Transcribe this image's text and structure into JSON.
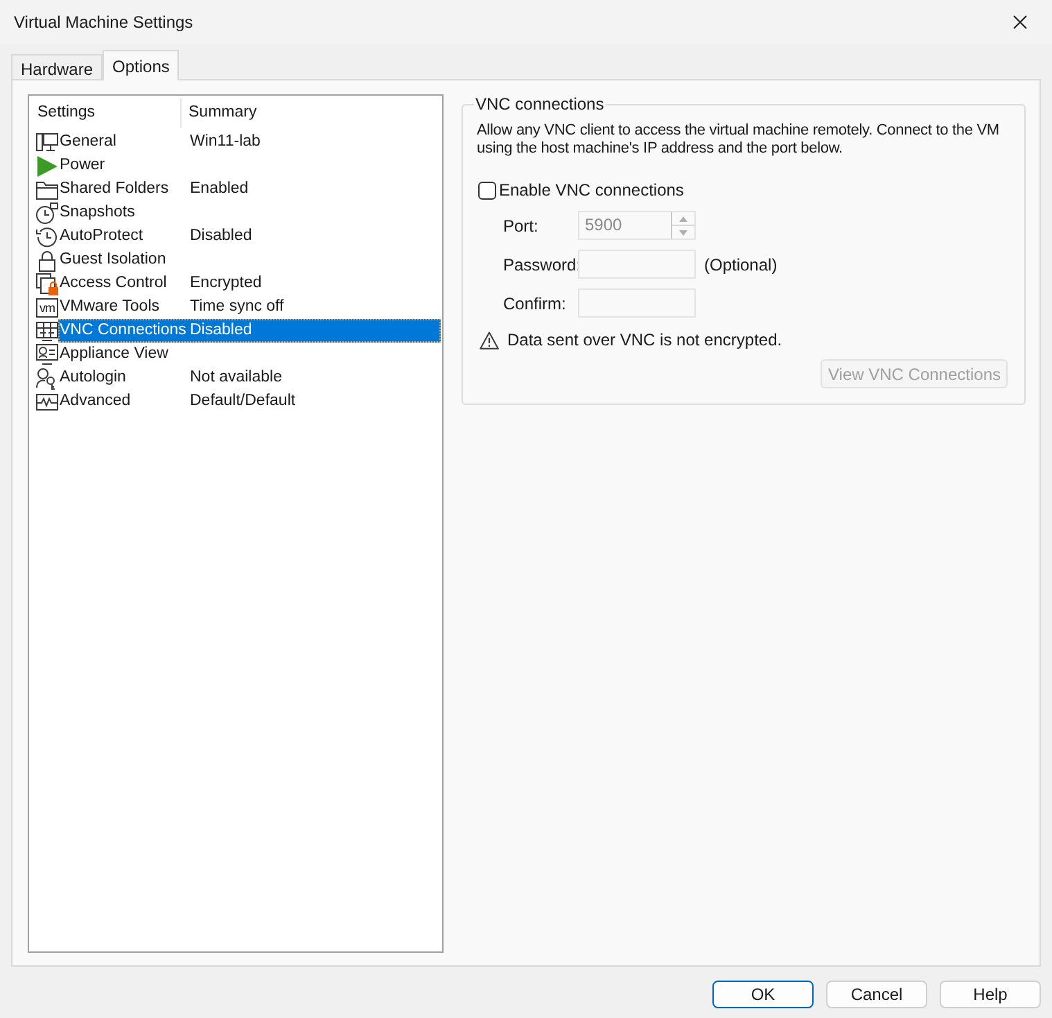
{
  "window": {
    "title": "Virtual Machine Settings"
  },
  "tabs": [
    {
      "label": "Hardware",
      "selected": false
    },
    {
      "label": "Options",
      "selected": true
    }
  ],
  "settings": {
    "columns": [
      "Settings",
      "Summary"
    ],
    "rows": [
      {
        "name": "General",
        "summary": "Win11-lab",
        "selected": false
      },
      {
        "name": "Power",
        "selected": false
      },
      {
        "name": "Shared Folders",
        "summary": "Enabled",
        "selected": false
      },
      {
        "name": "Snapshots",
        "selected": false
      },
      {
        "name": "AutoProtect",
        "summary": "Disabled",
        "selected": false
      },
      {
        "name": "Guest Isolation",
        "selected": false
      },
      {
        "name": "Access Control",
        "summary": "Encrypted",
        "selected": false
      },
      {
        "name": "VMware Tools",
        "summary": "Time sync off",
        "logo": "vm",
        "selected": false
      },
      {
        "name": "VNC Connections",
        "summary": "Disabled",
        "selected": true
      },
      {
        "name": "Appliance View",
        "selected": false
      },
      {
        "name": "Autologin",
        "summary": "Not available",
        "selected": false
      },
      {
        "name": "Advanced",
        "summary": "Default/Default",
        "selected": false
      }
    ]
  },
  "vnc": {
    "legend": "VNC connections",
    "description": "Allow any VNC client to access the virtual machine remotely. Connect to the VM using the host machine's IP address and the port below.",
    "enable": {
      "label": "Enable VNC connections",
      "checked": false
    },
    "fields": [
      {
        "kind": "spinner",
        "label": "Port:",
        "value": "5900",
        "disabled": true
      },
      {
        "kind": "text",
        "label": "Password:",
        "note": "(Optional)",
        "disabled": true
      },
      {
        "kind": "text",
        "label": "Confirm:",
        "disabled": true
      }
    ],
    "warning": "Data sent over VNC is not encrypted.",
    "view_button": {
      "label": "View VNC Connections",
      "disabled": true
    }
  },
  "buttons": [
    {
      "label": "OK",
      "default": true
    },
    {
      "label": "Cancel",
      "default": false
    },
    {
      "label": "Help",
      "default": false
    }
  ]
}
